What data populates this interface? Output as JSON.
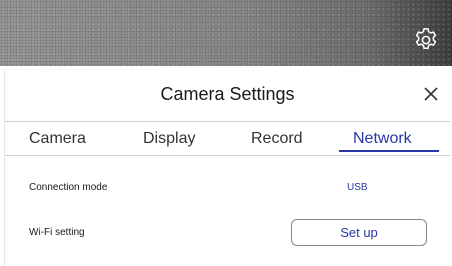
{
  "dialog": {
    "title": "Camera Settings",
    "close_icon": "close-icon",
    "open_icon": "gear-icon"
  },
  "tabs": [
    {
      "label": "Camera",
      "active": false
    },
    {
      "label": "Display",
      "active": false
    },
    {
      "label": "Record",
      "active": false
    },
    {
      "label": "Network",
      "active": true
    }
  ],
  "network": {
    "connection_mode_label": "Connection mode",
    "connection_mode_value": "USB",
    "wifi_setting_label": "Wi-Fi setting",
    "wifi_setup_button": "Set up"
  },
  "colors": {
    "accent": "#2a36a8",
    "text": "#1a1a1a",
    "divider": "#cfcfcf"
  }
}
